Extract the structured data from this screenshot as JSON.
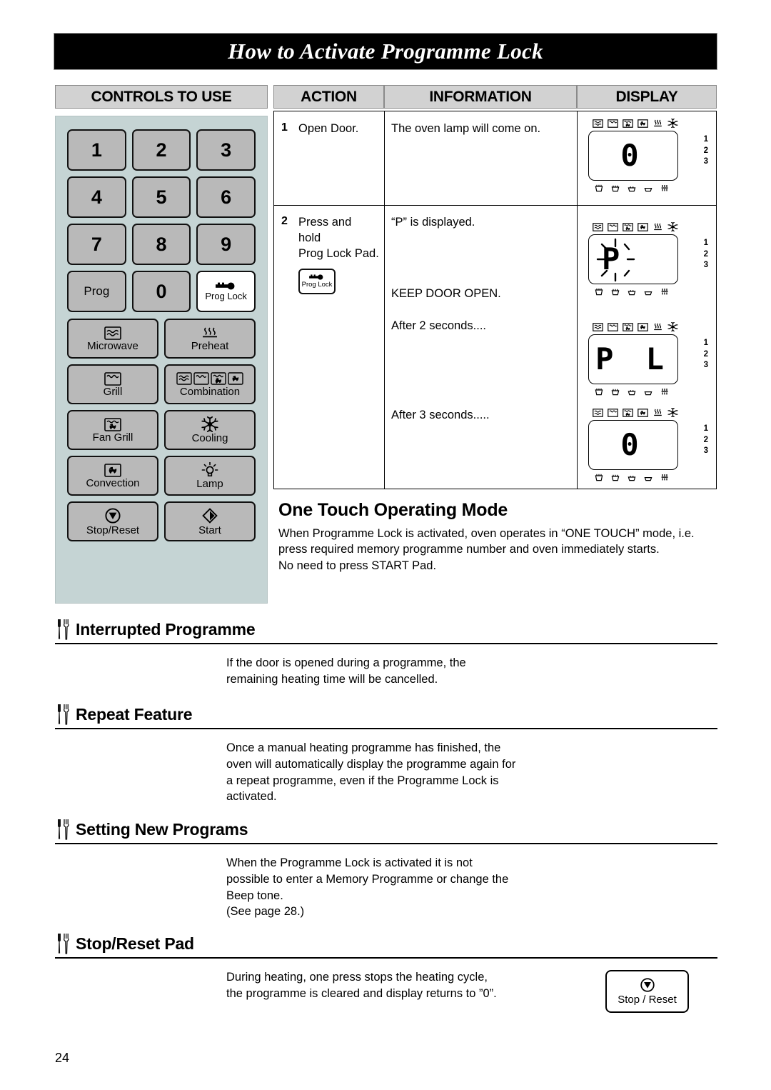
{
  "page": {
    "title": "How to Activate Programme Lock",
    "number": "24"
  },
  "headers": {
    "controls_to_use": "CONTROLS TO USE",
    "action": "ACTION",
    "information": "INFORMATION",
    "display": "DISPLAY"
  },
  "control_panel": {
    "keypad": [
      {
        "label": "1",
        "icon": ""
      },
      {
        "label": "2",
        "icon": ""
      },
      {
        "label": "3",
        "icon": ""
      },
      {
        "label": "4",
        "icon": ""
      },
      {
        "label": "5",
        "icon": ""
      },
      {
        "label": "6",
        "icon": ""
      },
      {
        "label": "7",
        "icon": ""
      },
      {
        "label": "8",
        "icon": ""
      },
      {
        "label": "9",
        "icon": ""
      },
      {
        "label": "Prog",
        "icon": ""
      },
      {
        "label": "0",
        "icon": ""
      },
      {
        "label": "Prog Lock",
        "icon": "key-icon"
      }
    ],
    "functions": [
      {
        "label": "Microwave",
        "icon": "microwave-wave-icon"
      },
      {
        "label": "Preheat",
        "icon": "heat-waves-icon"
      },
      {
        "label": "Grill",
        "icon": "grill-element-icon"
      },
      {
        "label": "Combination",
        "icon": "combination-modes-icon"
      },
      {
        "label": "Fan Grill",
        "icon": "fan-grill-icon"
      },
      {
        "label": "Cooling",
        "icon": "cooling-fan-icon"
      },
      {
        "label": "Convection",
        "icon": "convection-fan-icon"
      },
      {
        "label": "Lamp",
        "icon": "lamp-icon"
      },
      {
        "label": "Stop/Reset",
        "icon": "stop-octagon-icon"
      },
      {
        "label": "Start",
        "icon": "start-diamond-icon"
      }
    ]
  },
  "steps": [
    {
      "number": "1",
      "action": "Open Door.",
      "information": "The oven lamp will come on.",
      "display_digits": "0"
    },
    {
      "number": "2",
      "action_line1": "Press and",
      "action_line2": "hold",
      "action_line3": "Prog Lock Pad.",
      "action_pad_label": "Prog Lock",
      "information_1": "“P” is displayed.",
      "information_2": "KEEP DOOR OPEN.",
      "information_3": "After 2 seconds....",
      "information_4": "After 3 seconds.....",
      "display_1_digits": "P",
      "display_1_flashing": true,
      "display_2_digits": "P L",
      "display_3_digits": "0"
    }
  ],
  "lcd": {
    "top_indicators": [
      "microwave-icon",
      "grill-icon",
      "fan-grill-icon",
      "convection-icon",
      "preheat-icon",
      "cooling-icon"
    ],
    "bottom_indicators": [
      "shelf-1-icon",
      "shelf-2-icon",
      "shelf-3-icon",
      "shelf-4-icon",
      "double-shelf-icon"
    ],
    "shelf_numbers": [
      "1",
      "2",
      "3"
    ]
  },
  "one_touch": {
    "heading": "One Touch Operating Mode",
    "body": "When Programme Lock is activated, oven operates in “ONE TOUCH” mode, i.e. press required memory programme number and oven immediately starts.\nNo need to press START Pad."
  },
  "sections": [
    {
      "heading": "Interrupted Programme",
      "icon": "knife-fork-icon",
      "body": "If the door is opened during a programme, the\nremaining heating time will be cancelled."
    },
    {
      "heading": "Repeat Feature",
      "icon": "knife-fork-icon",
      "body": "Once a manual heating programme has finished, the\noven will automatically display the programme again for\na repeat programme, even if the Programme Lock is\nactivated."
    },
    {
      "heading": "Setting New Programs",
      "icon": "knife-fork-icon",
      "body": "When the Programme Lock is activated it is not\npossible to enter a Memory Programme or change the\nBeep tone.\n(See page 28.)"
    },
    {
      "heading": "Stop/Reset Pad",
      "icon": "knife-fork-icon",
      "body": "During heating, one press stops the heating cycle,\nthe programme is cleared and display returns to ”0”.",
      "pad_label": "Stop / Reset"
    }
  ],
  "colors": {
    "panel_bg": "#c5d4d4",
    "key_face": "#b9b9b9",
    "header_bg": "#d2d2d2",
    "title_bg": "#000000"
  }
}
